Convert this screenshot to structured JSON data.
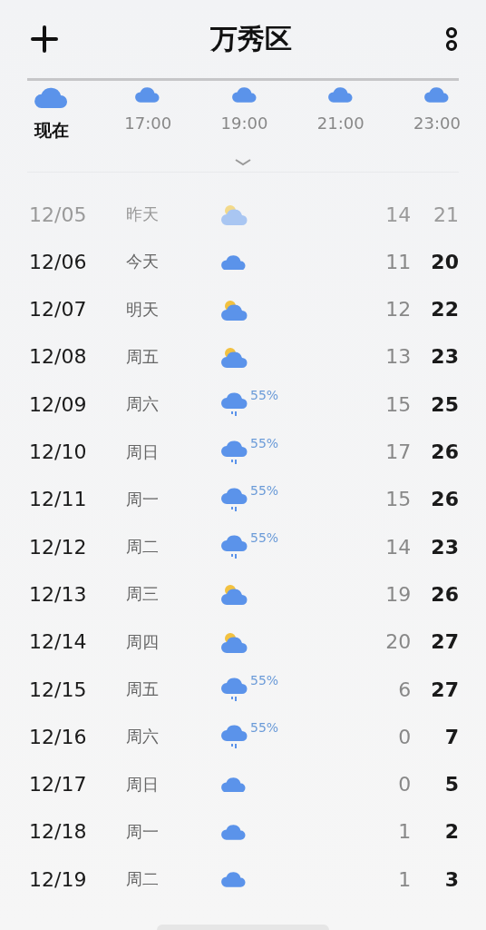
{
  "header": {
    "title": "万秀区"
  },
  "hourly": [
    {
      "label": "现在",
      "selected": true,
      "kind": "cloudy"
    },
    {
      "label": "17:00",
      "selected": false,
      "kind": "cloudy"
    },
    {
      "label": "19:00",
      "selected": false,
      "kind": "cloudy"
    },
    {
      "label": "21:00",
      "selected": false,
      "kind": "cloudy"
    },
    {
      "label": "23:00",
      "selected": false,
      "kind": "cloudy"
    }
  ],
  "days": [
    {
      "date": "12/05",
      "weekday": "昨天",
      "kind": "partly_cloudy",
      "past": true,
      "low": "14",
      "high": "21"
    },
    {
      "date": "12/06",
      "weekday": "今天",
      "kind": "cloudy",
      "past": false,
      "low": "11",
      "high": "20"
    },
    {
      "date": "12/07",
      "weekday": "明天",
      "kind": "partly_cloudy",
      "past": false,
      "low": "12",
      "high": "22"
    },
    {
      "date": "12/08",
      "weekday": "周五",
      "kind": "partly_cloudy",
      "past": false,
      "low": "13",
      "high": "23"
    },
    {
      "date": "12/09",
      "weekday": "周六",
      "kind": "rain",
      "precip": "55%",
      "past": false,
      "low": "15",
      "high": "25"
    },
    {
      "date": "12/10",
      "weekday": "周日",
      "kind": "rain",
      "precip": "55%",
      "past": false,
      "low": "17",
      "high": "26"
    },
    {
      "date": "12/11",
      "weekday": "周一",
      "kind": "rain",
      "precip": "55%",
      "past": false,
      "low": "15",
      "high": "26"
    },
    {
      "date": "12/12",
      "weekday": "周二",
      "kind": "rain",
      "precip": "55%",
      "past": false,
      "low": "14",
      "high": "23"
    },
    {
      "date": "12/13",
      "weekday": "周三",
      "kind": "partly_cloudy",
      "past": false,
      "low": "19",
      "high": "26"
    },
    {
      "date": "12/14",
      "weekday": "周四",
      "kind": "partly_cloudy",
      "past": false,
      "low": "20",
      "high": "27"
    },
    {
      "date": "12/15",
      "weekday": "周五",
      "kind": "rain",
      "precip": "55%",
      "past": false,
      "low": "6",
      "high": "27"
    },
    {
      "date": "12/16",
      "weekday": "周六",
      "kind": "rain",
      "precip": "55%",
      "past": false,
      "low": "0",
      "high": "7"
    },
    {
      "date": "12/17",
      "weekday": "周日",
      "kind": "cloudy",
      "past": false,
      "low": "0",
      "high": "5"
    },
    {
      "date": "12/18",
      "weekday": "周一",
      "kind": "cloudy",
      "past": false,
      "low": "1",
      "high": "2"
    },
    {
      "date": "12/19",
      "weekday": "周二",
      "kind": "cloudy",
      "past": false,
      "low": "1",
      "high": "3"
    }
  ]
}
